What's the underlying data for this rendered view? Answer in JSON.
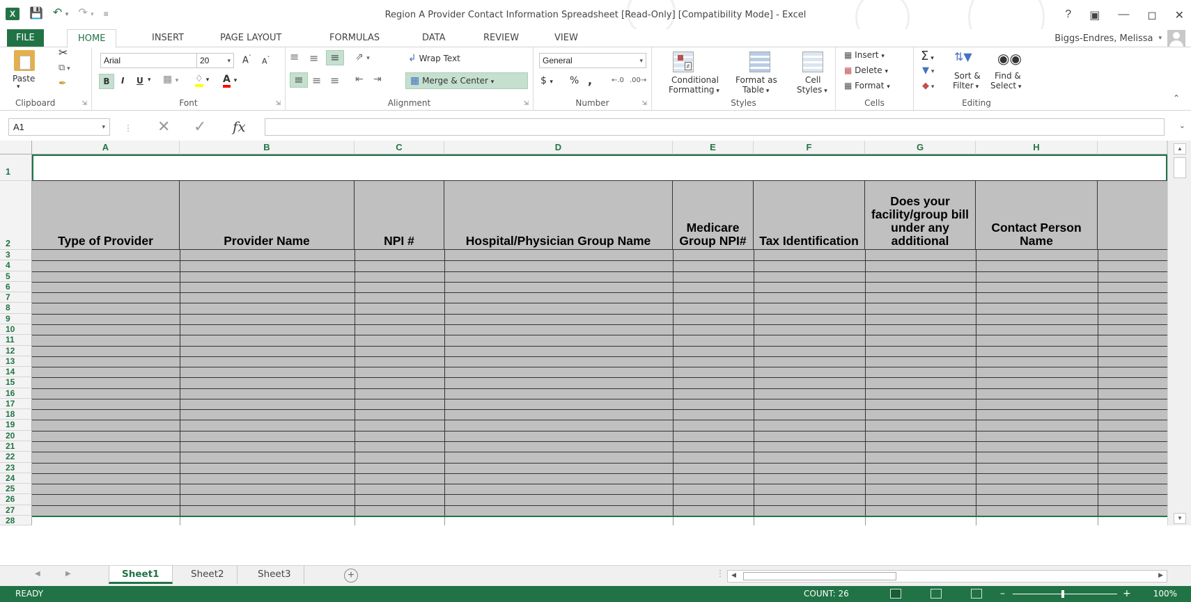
{
  "window": {
    "title": "Region A Provider Contact Information Spreadsheet  [Read-Only]  [Compatibility Mode] - Excel",
    "user": "Biggs-Endres, Melissa",
    "help": "?"
  },
  "tabs": [
    "FILE",
    "HOME",
    "INSERT",
    "PAGE LAYOUT",
    "FORMULAS",
    "DATA",
    "REVIEW",
    "VIEW"
  ],
  "active_tab": "HOME",
  "ribbon": {
    "clipboard": {
      "label": "Clipboard",
      "paste": "Paste"
    },
    "font": {
      "label": "Font",
      "name": "Arial",
      "size": "20",
      "bold": "B",
      "italic": "I",
      "underline": "U"
    },
    "alignment": {
      "label": "Alignment",
      "wrap": "Wrap Text",
      "merge": "Merge & Center"
    },
    "number": {
      "label": "Number",
      "format": "General",
      "currency": "$",
      "percent": "%",
      "comma": ","
    },
    "styles": {
      "label": "Styles",
      "conditional_1": "Conditional",
      "conditional_2": "Formatting",
      "format_table_1": "Format as",
      "format_table_2": "Table",
      "cell_styles_1": "Cell",
      "cell_styles_2": "Styles"
    },
    "cells": {
      "label": "Cells",
      "insert": "Insert",
      "delete": "Delete",
      "format": "Format"
    },
    "editing": {
      "label": "Editing",
      "sort_1": "Sort &",
      "sort_2": "Filter",
      "find_1": "Find &",
      "find_2": "Select"
    }
  },
  "formula_bar": {
    "name_box": "A1",
    "fx": "fx",
    "value": ""
  },
  "columns": [
    "A",
    "B",
    "C",
    "D",
    "E",
    "F",
    "G",
    "H"
  ],
  "row_numbers": [
    "1",
    "2",
    "3",
    "4",
    "5",
    "6",
    "7",
    "8",
    "9",
    "10",
    "11",
    "12",
    "13",
    "14",
    "15",
    "16",
    "17",
    "18",
    "19",
    "20",
    "21",
    "22",
    "23",
    "24",
    "25",
    "26",
    "27",
    "28"
  ],
  "header_cells": [
    "Type of Provider",
    "Provider Name",
    "NPI #",
    "Hospital/Physician Group Name",
    "Medicare Group NPI#",
    "Tax Identification",
    "Does your facility/group bill under any additional",
    "Contact Person Name"
  ],
  "sheets": [
    "Sheet1",
    "Sheet2",
    "Sheet3"
  ],
  "active_sheet": "Sheet1",
  "status": {
    "mode": "READY",
    "count": "COUNT: 26",
    "zoom": "100%"
  },
  "colors": {
    "excel_green": "#217346",
    "header_gray": "#C0C0C0"
  }
}
